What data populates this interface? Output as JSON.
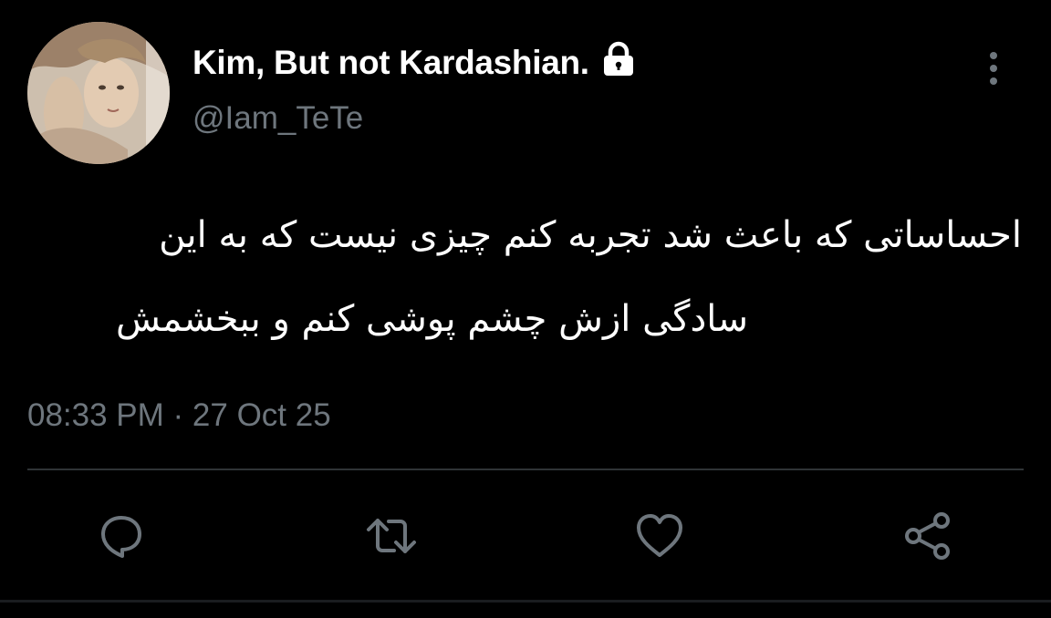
{
  "tweet": {
    "author": {
      "display_name": "Kim, But not Kardashian.",
      "handle": "@Iam_TeTe",
      "protected_icon": "lock-icon",
      "avatar": "profile-photo"
    },
    "text_lines": [
      "احساساتی که باعث شد تجربه کنم چیزی نیست که به این",
      "سادگی ازش چشم پوشی کنم و ببخشمش"
    ],
    "timestamp": "08:33 PM · 27 Oct 25",
    "menu_icon": "more-vertical-icon",
    "actions": [
      {
        "name": "reply",
        "icon": "reply-icon"
      },
      {
        "name": "retweet",
        "icon": "retweet-icon"
      },
      {
        "name": "like",
        "icon": "heart-icon"
      },
      {
        "name": "share",
        "icon": "share-icon"
      }
    ]
  },
  "colors": {
    "background": "#000000",
    "text_primary": "#ffffff",
    "text_secondary": "#6e767d",
    "divider": "#2f3336",
    "icon": "#6e767d"
  }
}
